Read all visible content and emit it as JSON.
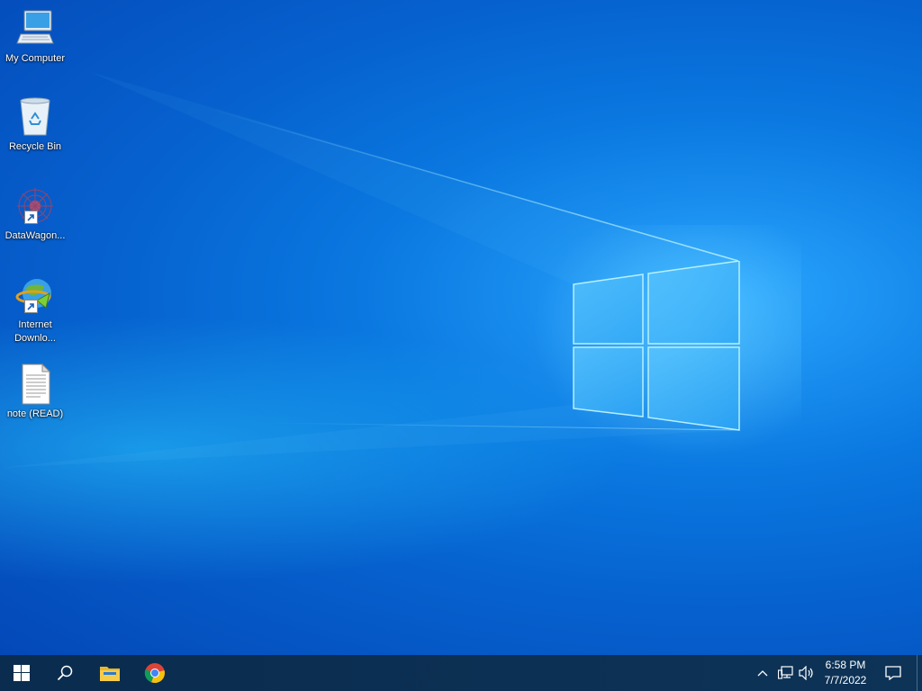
{
  "desktop": {
    "icons": [
      {
        "label": "My Computer",
        "icon": "computer-icon"
      },
      {
        "label": "Recycle Bin",
        "icon": "recycle-bin-icon"
      },
      {
        "label": "DataWagon...",
        "icon": "datawagon-icon",
        "shortcut": true
      },
      {
        "label": "Internet Downlo...",
        "icon": "internet-download-manager-icon",
        "shortcut": true
      },
      {
        "label": "note (READ)",
        "icon": "text-document-icon"
      }
    ]
  },
  "taskbar": {
    "start_icon": "windows-start-icon",
    "search_icon": "search-icon",
    "pinned": [
      {
        "name": "File Explorer",
        "icon": "folder-icon"
      },
      {
        "name": "Google Chrome",
        "icon": "chrome-icon"
      }
    ],
    "tray": {
      "chevron_icon": "chevron-up-icon",
      "network_icon": "network-icon",
      "volume_icon": "volume-icon",
      "notification_icon": "action-center-icon"
    },
    "clock": {
      "time": "6:58 PM",
      "date": "7/7/2022"
    }
  },
  "colors": {
    "desktop_blue": "#0a78e0",
    "taskbar": "#0c2f52",
    "text": "#ffffff"
  }
}
